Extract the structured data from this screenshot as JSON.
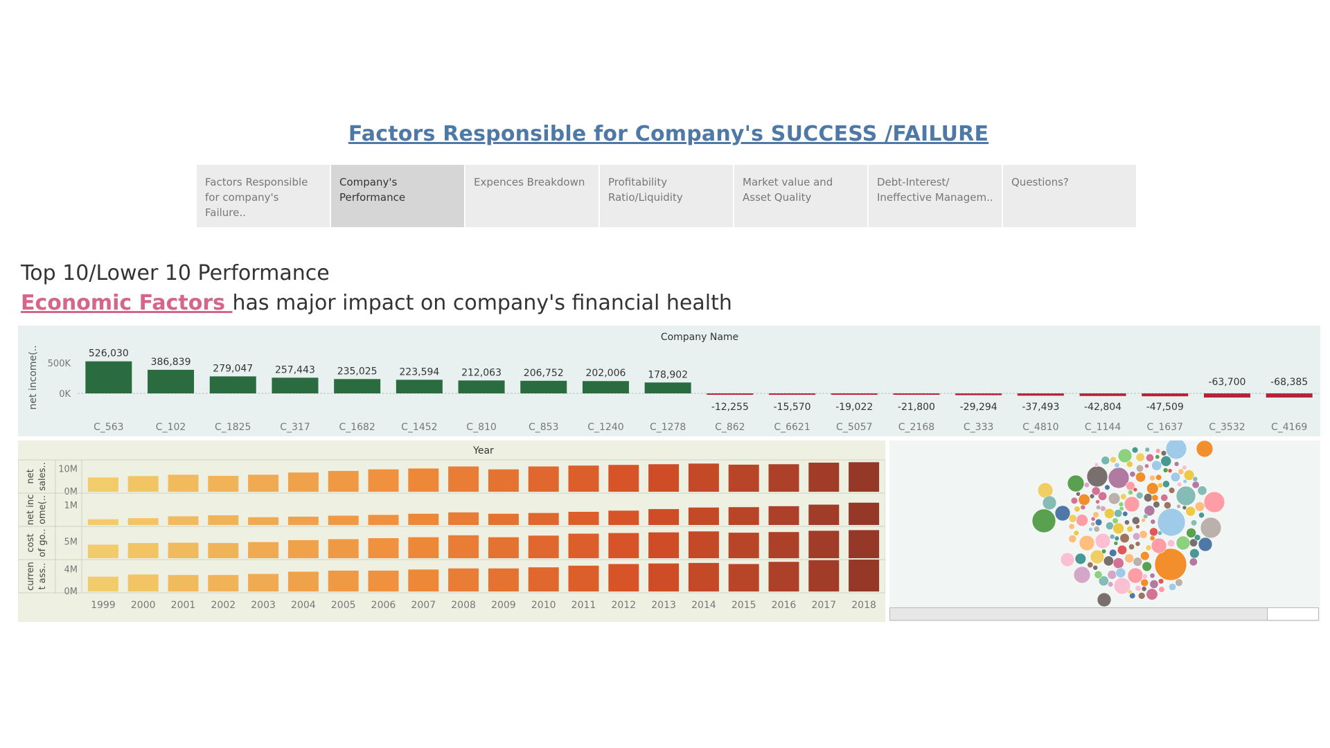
{
  "header": {
    "title": "Factors Responsible for Company's SUCCESS /FAILURE"
  },
  "tabs": [
    {
      "label": "Factors Responsible\nfor company's Failure..",
      "active": false
    },
    {
      "label": "Company's\nPerformance",
      "active": true
    },
    {
      "label": "Expences Breakdown",
      "active": false
    },
    {
      "label": "Profitability\nRatio/Liquidity",
      "active": false
    },
    {
      "label": "Market value and\nAsset Quality",
      "active": false
    },
    {
      "label": "Debt-Interest/\nIneffective Managem..",
      "active": false
    },
    {
      "label": "Questions?",
      "active": false
    }
  ],
  "headings": {
    "line1": "Top 10/Lower 10 Performance",
    "line2_link": "Economic Factors ",
    "line2_rest": "has major impact on company's financial health"
  },
  "colors": {
    "positive": "#2a6b3f",
    "negative": "#b8223b",
    "top_panel_bg": "#e8f1ef",
    "year_panel_bg": "#eef0e2",
    "title_blue": "#4e79a7",
    "link_pink": "#d4668a"
  },
  "chart_data": [
    {
      "type": "bar",
      "title": "Company Name",
      "ylabel": "net income(..",
      "yticks": [
        "500K",
        "0K"
      ],
      "ylim": [
        -100000,
        600000
      ],
      "categories": [
        "C_563",
        "C_102",
        "C_1825",
        "C_317",
        "C_1682",
        "C_1452",
        "C_810",
        "C_853",
        "C_1240",
        "C_1278",
        "C_862",
        "C_6621",
        "C_5057",
        "C_2168",
        "C_333",
        "C_4810",
        "C_1144",
        "C_1637",
        "C_3532",
        "C_4169"
      ],
      "values": [
        526030,
        386839,
        279047,
        257443,
        235025,
        223594,
        212063,
        206752,
        202006,
        178902,
        -12255,
        -15570,
        -19022,
        -21800,
        -29294,
        -37493,
        -42804,
        -47509,
        -63700,
        -68385
      ],
      "labels": [
        "526,030",
        "386,839",
        "279,047",
        "257,443",
        "235,025",
        "223,594",
        "212,063",
        "206,752",
        "202,006",
        "178,902",
        "-12,255",
        "-15,570",
        "-19,022",
        "-21,800",
        "-29,294",
        "-37,493",
        "-42,804",
        "-47,509",
        "-63,700",
        "-68,385"
      ]
    },
    {
      "type": "bar",
      "title": "Year",
      "categories": [
        "1999",
        "2000",
        "2001",
        "2002",
        "2003",
        "2004",
        "2005",
        "2006",
        "2007",
        "2008",
        "2009",
        "2010",
        "2011",
        "2012",
        "2013",
        "2014",
        "2015",
        "2016",
        "2017",
        "2018"
      ],
      "series": [
        {
          "name": "net sales..",
          "ylabel_lines": [
            "net",
            "sales.."
          ],
          "yticks": [
            "10M",
            "0M"
          ],
          "ylim": [
            0,
            13000000
          ],
          "values": [
            6400000,
            7000000,
            7600000,
            7100000,
            7600000,
            8600000,
            9300000,
            10000000,
            10400000,
            11300000,
            10000000,
            11300000,
            11700000,
            12000000,
            12300000,
            12600000,
            12100000,
            12300000,
            13000000,
            13200000
          ]
        },
        {
          "name": "net income..",
          "ylabel_lines": [
            "net inc",
            "ome(.."
          ],
          "yticks": [
            "1M"
          ],
          "ylim": [
            0,
            1500000
          ],
          "values": [
            300000,
            350000,
            450000,
            500000,
            400000,
            430000,
            480000,
            520000,
            580000,
            650000,
            580000,
            620000,
            680000,
            740000,
            820000,
            900000,
            920000,
            970000,
            1050000,
            1150000
          ]
        },
        {
          "name": "cost of go..",
          "ylabel_lines": [
            "cost",
            "of go.."
          ],
          "yticks": [
            "5M"
          ],
          "ylim": [
            0,
            9000000
          ],
          "values": [
            4200000,
            4700000,
            4800000,
            4700000,
            5000000,
            5600000,
            5900000,
            6200000,
            6500000,
            7100000,
            6500000,
            7000000,
            7600000,
            7800000,
            8000000,
            8300000,
            7900000,
            8100000,
            8500000,
            8700000
          ]
        },
        {
          "name": "current ass..",
          "ylabel_lines": [
            "curren",
            "t ass.."
          ],
          "yticks": [
            "4M",
            "0M"
          ],
          "ylim": [
            0,
            5300000
          ],
          "values": [
            2700000,
            3100000,
            3000000,
            3000000,
            3200000,
            3600000,
            3800000,
            3800000,
            4000000,
            4200000,
            4200000,
            4400000,
            4700000,
            5000000,
            5100000,
            5200000,
            5000000,
            5400000,
            5700000,
            5800000
          ]
        }
      ]
    }
  ],
  "bubble_chart": {
    "palette": [
      "#4e79a7",
      "#f28e2b",
      "#e15759",
      "#76b7b2",
      "#59a14f",
      "#edc948",
      "#b07aa1",
      "#ff9da7",
      "#9c755f",
      "#bab0ac",
      "#a0cbe8",
      "#ffbe7d",
      "#8cd17d",
      "#f1ce63",
      "#86bcb6",
      "#fabfd2",
      "#d4a6c8",
      "#d37295",
      "#79706e",
      "#499894"
    ]
  }
}
